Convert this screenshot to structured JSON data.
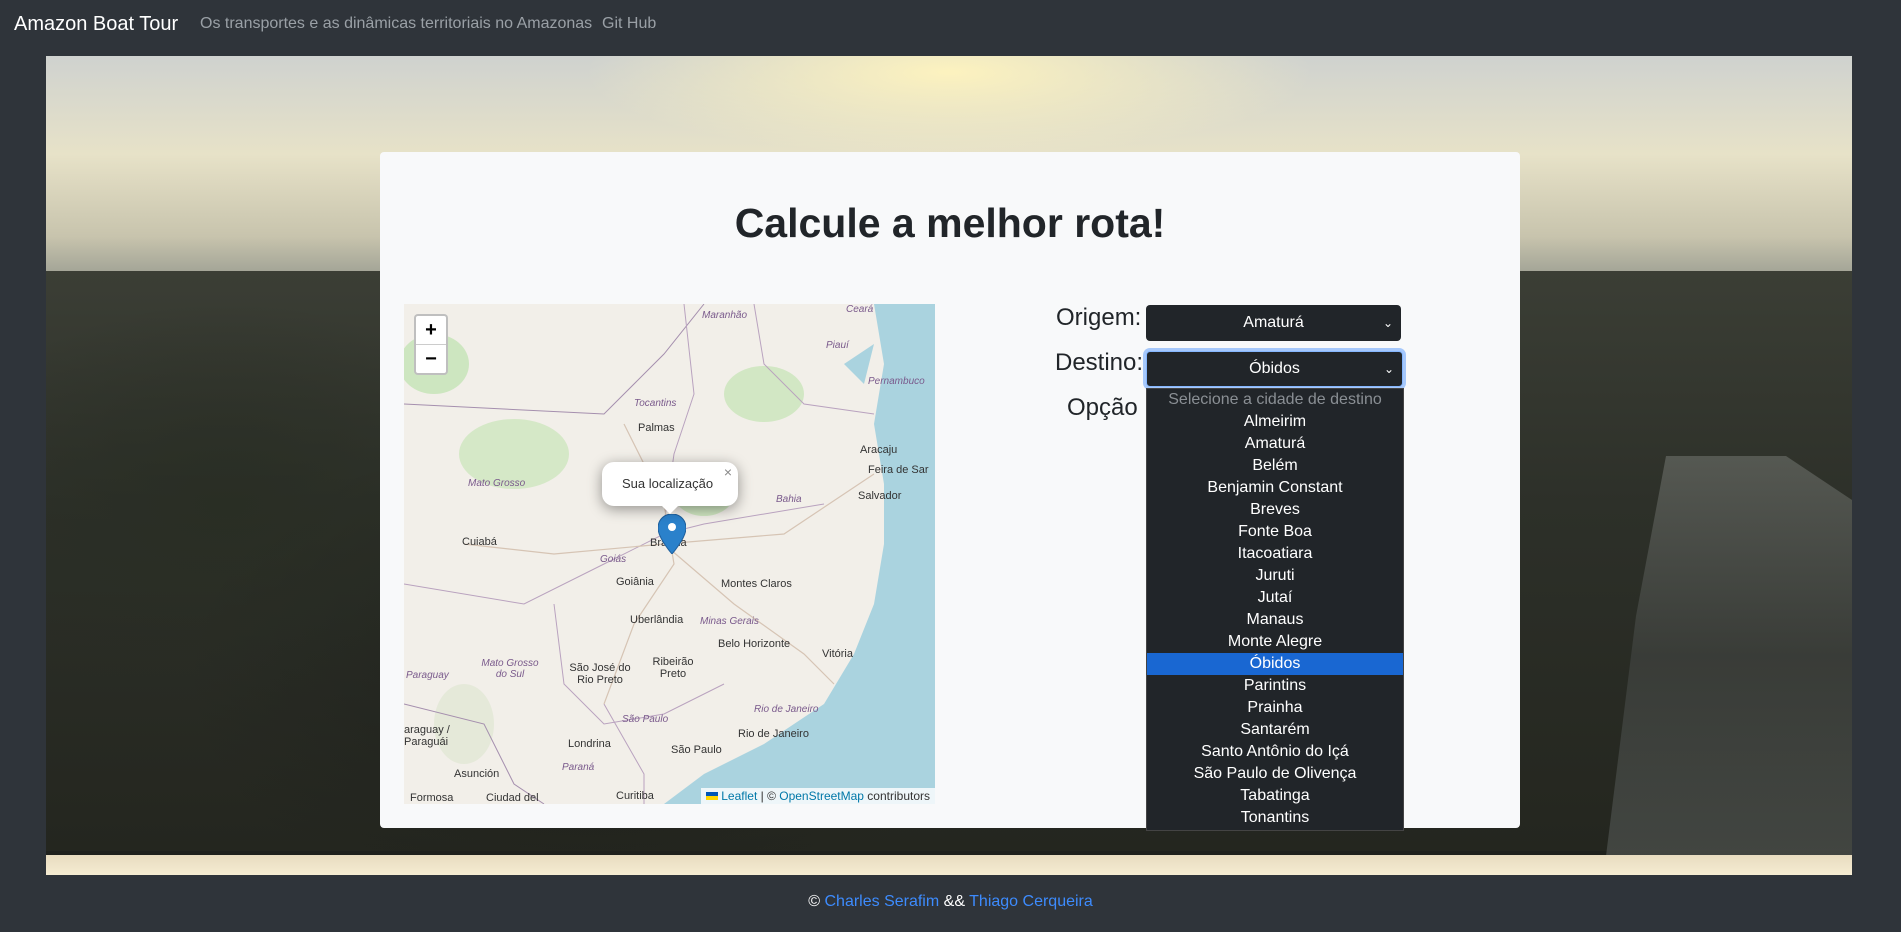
{
  "navbar": {
    "brand": "Amazon Boat Tour",
    "links": [
      "Os transportes e as dinâmicas territoriais no Amazonas",
      "Git Hub"
    ]
  },
  "card": {
    "title": "Calcule a melhor rota!"
  },
  "map": {
    "zoom_in": "+",
    "zoom_out": "−",
    "popup_text": "Sua localização",
    "popup_close": "×",
    "attribution": {
      "leaflet": "Leaflet",
      "separator": " | © ",
      "osm": "OpenStreetMap",
      "suffix": " contributors"
    },
    "cities": [
      {
        "name": "Palmas"
      },
      {
        "name": "Cuiabá"
      },
      {
        "name": "Brasília"
      },
      {
        "name": "Goiânia"
      },
      {
        "name": "Uberlândia"
      },
      {
        "name": "Montes Claros"
      },
      {
        "name": "Belo Horizonte"
      },
      {
        "name": "Salvador"
      },
      {
        "name": "Vitória"
      },
      {
        "name": "Ribeirão Preto"
      },
      {
        "name": "São José do Rio Preto"
      },
      {
        "name": "Londrina"
      },
      {
        "name": "São Paulo"
      },
      {
        "name": "Rio de Janeiro"
      },
      {
        "name": "Curitiba"
      },
      {
        "name": "Asunción"
      },
      {
        "name": "Formosa"
      },
      {
        "name": "Ciudad del"
      },
      {
        "name": "Aracaju"
      },
      {
        "name": "Feira de Sar"
      },
      {
        "name": "araguay / Paraguái"
      }
    ],
    "regions": [
      {
        "name": "Maranhão"
      },
      {
        "name": "Ceará"
      },
      {
        "name": "Piauí"
      },
      {
        "name": "Pernambuco"
      },
      {
        "name": "Tocantins"
      },
      {
        "name": "Mato Grosso"
      },
      {
        "name": "Bahia"
      },
      {
        "name": "Goiás"
      },
      {
        "name": "Minas Gerais"
      },
      {
        "name": "Mato Grosso do Sul"
      },
      {
        "name": "São Paulo"
      },
      {
        "name": "Rio de Janeiro"
      },
      {
        "name": "Paraná"
      },
      {
        "name": "Paraguay"
      }
    ]
  },
  "form": {
    "origem_label": "Origem:",
    "origem_value": "Amaturá",
    "destino_label": "Destino:",
    "destino_value": "Óbidos",
    "opcao_label": "Opção",
    "destino_options": [
      "Selecione a cidade de destino",
      "Almeirim",
      "Amaturá",
      "Belém",
      "Benjamin Constant",
      "Breves",
      "Fonte Boa",
      "Itacoatiara",
      "Juruti",
      "Jutaí",
      "Manaus",
      "Monte Alegre",
      "Óbidos",
      "Parintins",
      "Prainha",
      "Santarém",
      "Santo Antônio do Içá",
      "São Paulo de Olivença",
      "Tabatinga",
      "Tonantins"
    ],
    "selected_option": "Óbidos"
  },
  "footer": {
    "copyright": "©",
    "author1": "Charles Serafim",
    "joiner": "&&",
    "author2": "Thiago Cerqueira"
  },
  "colors": {
    "select_bg": "#212529",
    "selected_option": "#1967d2",
    "link": "#3d8bfd",
    "marker": "#2a81cb"
  }
}
